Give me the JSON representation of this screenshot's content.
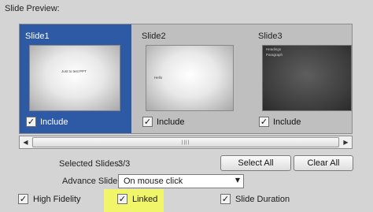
{
  "section_title": "Slide Preview:",
  "slides": [
    {
      "name": "Slide1",
      "thumb_text": "Just to test PPT",
      "include_label": "Include",
      "included": "✓",
      "selected": true
    },
    {
      "name": "Slide2",
      "thumb_text": "Hello",
      "include_label": "Include",
      "included": "✓",
      "selected": false
    },
    {
      "name": "Slide3",
      "thumb_text": "Headings",
      "thumb_text2": "Paragraph",
      "include_label": "Include",
      "included": "✓",
      "selected": false
    }
  ],
  "scrollbar": {
    "left_arrow": "◀",
    "right_arrow": "▶",
    "grip": "||||"
  },
  "selected_slides": {
    "label": "Selected Slides:",
    "value": "3/3"
  },
  "buttons": {
    "select_all": "Select All",
    "clear_all": "Clear All"
  },
  "advance_slide": {
    "label": "Advance Slide:",
    "value": "On mouse click",
    "arrow": "▼"
  },
  "options": {
    "high_fidelity": {
      "label": "High Fidelity",
      "check": "✓"
    },
    "linked": {
      "label": "Linked",
      "check": "✓"
    },
    "slide_duration": {
      "label": "Slide Duration",
      "check": "✓"
    }
  },
  "colors": {
    "selected_slide": "#2e5aa5",
    "highlight": "#f1f56a"
  }
}
